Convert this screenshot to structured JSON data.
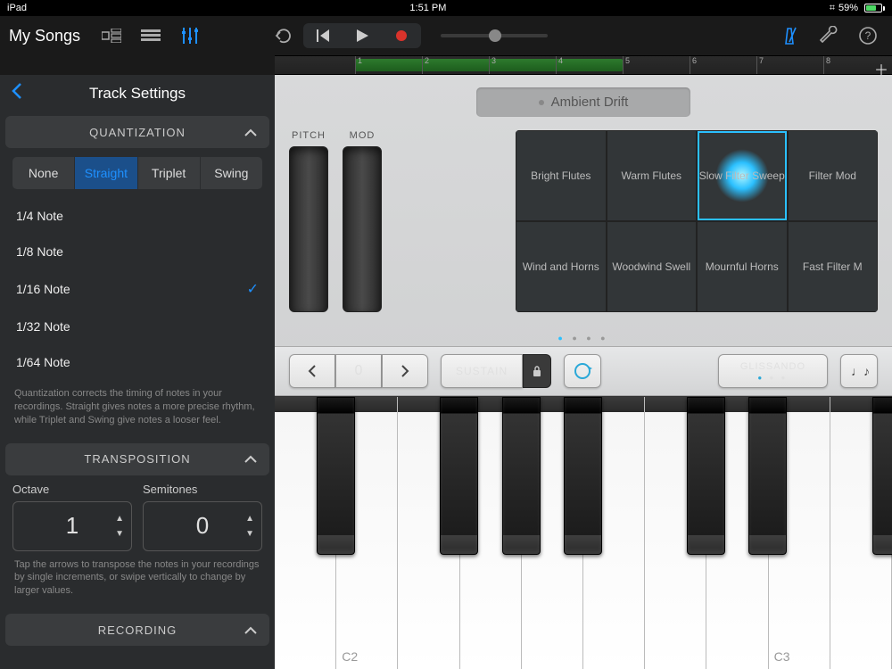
{
  "status": {
    "device": "iPad",
    "time": "1:51 PM",
    "battery": "59%"
  },
  "toolbar": {
    "back_label": "My Songs"
  },
  "ruler": {
    "bars": [
      "1",
      "2",
      "3",
      "4",
      "5",
      "6",
      "7",
      "8"
    ]
  },
  "sidebar": {
    "title": "Track Settings",
    "quantization": {
      "header": "QUANTIZATION",
      "modes": [
        "None",
        "Straight",
        "Triplet",
        "Swing"
      ],
      "selected_mode": "Straight",
      "notes": [
        "1/4 Note",
        "1/8 Note",
        "1/16 Note",
        "1/32 Note",
        "1/64 Note"
      ],
      "selected_note": "1/16 Note",
      "help": "Quantization corrects the timing of notes in your recordings. Straight gives notes a more precise rhythm, while Triplet and Swing give notes a looser feel."
    },
    "transposition": {
      "header": "TRANSPOSITION",
      "octave_label": "Octave",
      "octave_value": "1",
      "semitones_label": "Semitones",
      "semitones_value": "0",
      "help": "Tap the arrows to transpose the notes in your recordings by single increments, or swipe vertically to change by larger values."
    },
    "recording": {
      "header": "RECORDING"
    }
  },
  "instrument": {
    "patch": "Ambient Drift",
    "wheel_labels": {
      "pitch": "PITCH",
      "mod": "MOD"
    },
    "grid": [
      "Bright Flutes",
      "Warm Flutes",
      "Slow Filter Sweep",
      "Filter Mod",
      "Wind and Horns",
      "Woodwind Swell",
      "Mournful Horns",
      "Fast Filter M"
    ],
    "mid": {
      "octave_value": "0",
      "sustain": "SUSTAIN",
      "glissando": "GLISSANDO"
    },
    "key_labels": {
      "c2": "C2",
      "c3": "C3"
    }
  }
}
